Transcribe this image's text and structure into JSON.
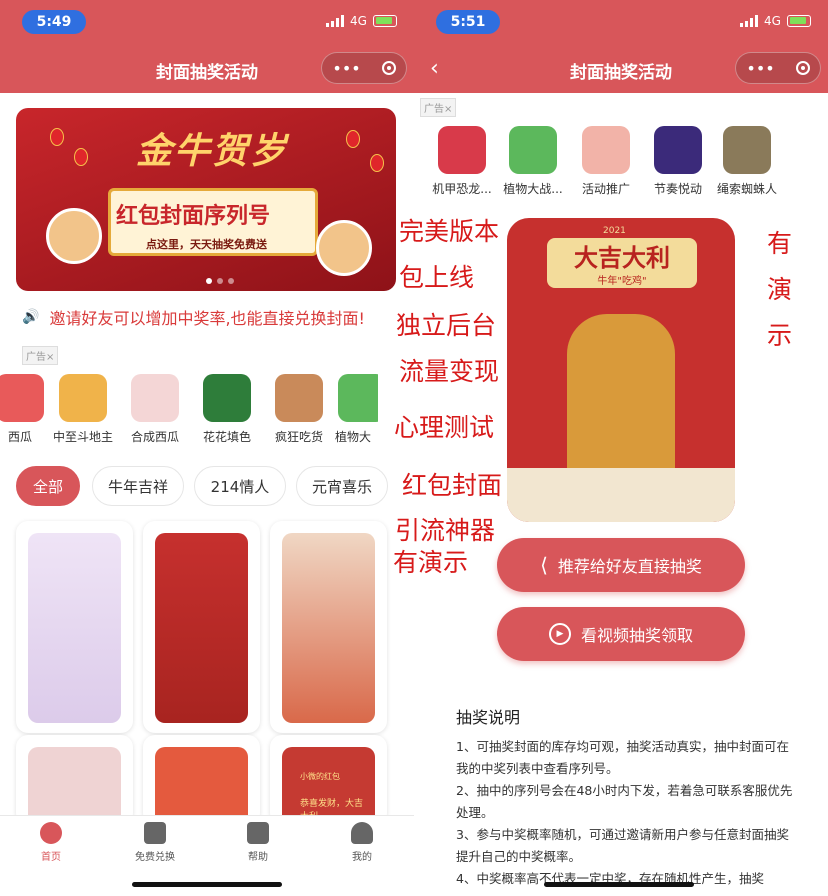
{
  "left": {
    "status": {
      "time": "5:49",
      "network": "4G"
    },
    "nav": {
      "title": "封面抽奖活动"
    },
    "banner": {
      "title": "金牛贺岁",
      "subtitle": "红包封面序列号",
      "tagline": "点这里，天天抽奖免费送"
    },
    "notice": "邀请好友可以增加中奖率,也能直接兑换封面!",
    "ad_label": "广告×",
    "apps": [
      "西瓜",
      "中至斗地主",
      "合成西瓜",
      "花花填色",
      "疯狂吃货",
      "植物大"
    ],
    "chips": [
      "全部",
      "牛年吉祥",
      "214情人",
      "元宵喜乐"
    ],
    "cards_bottom_text": [
      "小微的红包",
      "恭喜发财，大吉大利"
    ],
    "tabs": [
      "首页",
      "免费兑换",
      "帮助",
      "我的"
    ]
  },
  "right": {
    "status": {
      "time": "5:51",
      "network": "4G"
    },
    "nav": {
      "title": "封面抽奖活动"
    },
    "ad_label": "广告×",
    "apps": [
      "机甲恐龙...",
      "植物大战...",
      "活动推广",
      "节奏悦动",
      "绳索蜘蛛人"
    ],
    "poster": {
      "title": "大吉大利",
      "subtitle": "牛年\"吃鸡\"",
      "year": "2021"
    },
    "btn_share": "推荐给好友直接抽奖",
    "btn_video": "看视频抽奖领取",
    "rules_title": "抽奖说明",
    "rules": [
      "1、可抽奖封面的库存均可观，抽奖活动真实，抽中封面可在我的中奖列表中查看序列号。",
      "2、抽中的序列号会在48小时内下发，若着急可联系客服优先处理。",
      "3、参与中奖概率随机，可通过邀请新用户参与任意封面抽奖提升自己的中奖概率。",
      "4、中奖概率高不代表一定中奖，存在随机性产生，抽奖"
    ]
  },
  "overlay": {
    "middle_lines": [
      "完美版本",
      "包上线",
      "独立后台",
      "流量变现",
      "心理测试",
      "红包封面",
      "引流神器",
      "有演示"
    ],
    "right_lines": [
      "有",
      "演",
      "示"
    ]
  },
  "colors": {
    "brand": "#d8565a",
    "overlay_red": "#d71a1a",
    "time_pill": "#2f6fe0"
  }
}
